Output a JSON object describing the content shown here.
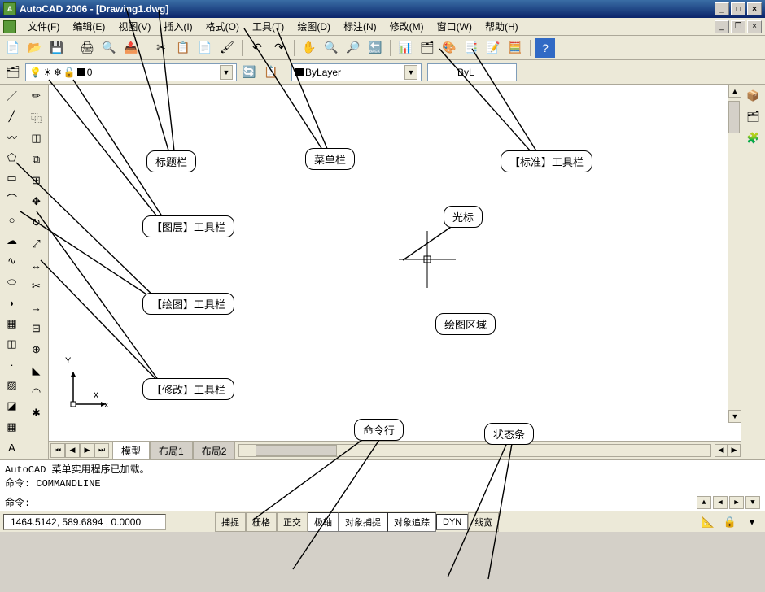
{
  "title": {
    "app_icon_label": "A",
    "text": "AutoCAD 2006 - [Drawing1.dwg]"
  },
  "menu": {
    "file": "文件(F)",
    "edit": "编辑(E)",
    "view": "视图(V)",
    "insert": "插入(I)",
    "format": "格式(O)",
    "tools": "工具(T)",
    "draw": "绘图(D)",
    "dimension": "标注(N)",
    "modify": "修改(M)",
    "window": "窗口(W)",
    "help": "帮助(H)"
  },
  "layer": {
    "current": "0"
  },
  "color": {
    "current": "ByLayer"
  },
  "lineweight": {
    "current": "ByL"
  },
  "canvas": {
    "ucs_x": "x",
    "ucs_y": "Y"
  },
  "tabs": {
    "model": "模型",
    "layout1": "布局1",
    "layout2": "布局2"
  },
  "command": {
    "history1": "AutoCAD 菜单实用程序已加载。",
    "history2": "命令: COMMANDLINE",
    "prompt": "命令:"
  },
  "status": {
    "coords": "1464.5142, 589.6894 , 0.0000",
    "snap": "捕捉",
    "grid": "栅格",
    "ortho": "正交",
    "polar": "极轴",
    "osnap": "对象捕捉",
    "otrack": "对象追踪",
    "dyn": "DYN",
    "lwt": "线宽"
  },
  "callouts": {
    "titlebar": "标题栏",
    "menubar": "菜单栏",
    "standard_toolbar": "【标准】工具栏",
    "layer_toolbar": "【图层】工具栏",
    "cursor": "光标",
    "draw_toolbar": "【绘图】工具栏",
    "drawing_area": "绘图区域",
    "modify_toolbar": "【修改】工具栏",
    "command_line": "命令行",
    "status_bar": "状态条"
  }
}
